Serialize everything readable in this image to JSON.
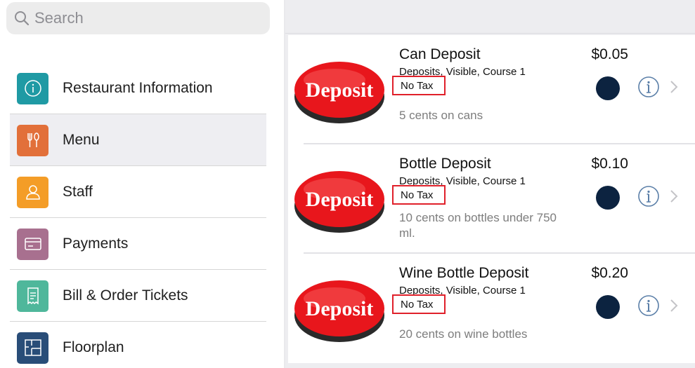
{
  "search": {
    "placeholder": "Search"
  },
  "sidebar": {
    "items": [
      {
        "label": "Restaurant Information",
        "icon": "info-icon",
        "color": "#1f9aa4",
        "active": false
      },
      {
        "label": "Menu",
        "icon": "fork-knife-icon",
        "color": "#e2703a",
        "active": true
      },
      {
        "label": "Staff",
        "icon": "person-icon",
        "color": "#f49d27",
        "active": false
      },
      {
        "label": "Payments",
        "icon": "credit-card-icon",
        "color": "#a8708f",
        "active": false
      },
      {
        "label": "Bill & Order Tickets",
        "icon": "receipt-icon",
        "color": "#4fb79b",
        "active": false
      },
      {
        "label": "Floorplan",
        "icon": "floorplan-icon",
        "color": "#294d78",
        "active": false
      }
    ]
  },
  "menu_items": [
    {
      "image_text": "Deposit",
      "name": "Can Deposit",
      "tags": "Deposits, Visible, Course 1",
      "tax": "No Tax",
      "description": "5 cents on cans",
      "price": "$0.05",
      "color": "#0c2340"
    },
    {
      "image_text": "Deposit",
      "name": "Bottle Deposit",
      "tags": "Deposits, Visible, Course 1",
      "tax": "No Tax",
      "description": "10 cents on bottles under 750 ml.",
      "price": "$0.10",
      "color": "#0c2340"
    },
    {
      "image_text": "Deposit",
      "name": "Wine Bottle Deposit",
      "tags": "Deposits, Visible, Course 1",
      "tax": "No Tax",
      "description": "20 cents on wine bottles",
      "price": "$0.20",
      "color": "#0c2340"
    }
  ]
}
